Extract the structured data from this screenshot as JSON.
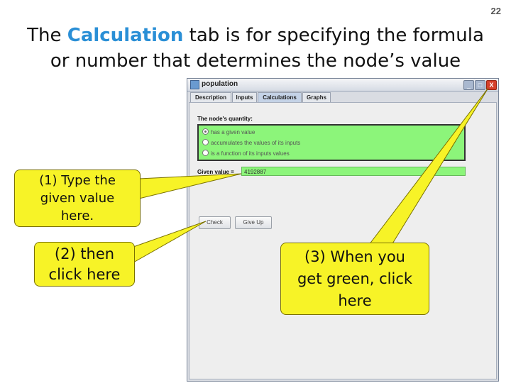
{
  "slide": {
    "number": "22"
  },
  "title": {
    "part1": "The ",
    "highlight": "Calculation",
    "part2": " tab is for specifying the formula",
    "line2": "or number that determines the node’s value"
  },
  "window": {
    "title": "population",
    "controls": {
      "minimize": "_",
      "maximize": "□",
      "close": "X"
    },
    "tabs": [
      {
        "label": "Description"
      },
      {
        "label": "Inputs"
      },
      {
        "label": "Calculations",
        "selected": true
      },
      {
        "label": "Graphs"
      }
    ],
    "quantity_label": "The node's quantity:",
    "radio_options": [
      {
        "label": "has a given value",
        "selected": true
      },
      {
        "label": "accumulates the values of its inputs",
        "selected": false
      },
      {
        "label": "is a function of its inputs values",
        "selected": false
      }
    ],
    "given_value_label": "Given value =",
    "given_value": "4192887",
    "buttons": {
      "check": "Check",
      "give_up": "Give Up"
    },
    "highlight_color": "#8cf57a"
  },
  "callouts": [
    {
      "lines": [
        "(1) Type the",
        "given value",
        "here."
      ]
    },
    {
      "lines": [
        "(2) then",
        "click here"
      ]
    },
    {
      "lines": [
        "(3) When you",
        "get green, click",
        "here"
      ]
    }
  ],
  "colors": {
    "callout": "#f7f327",
    "title_highlight": "#2a8fd6"
  }
}
